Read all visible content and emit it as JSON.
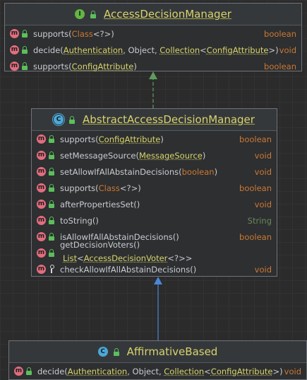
{
  "colors": {
    "canvas": "#2b2b2b",
    "box": "#2d2f31",
    "title": "#d9d46b",
    "keyword": "#cc7832",
    "string_type": "#6a8759",
    "method_icon": "#e36d7e",
    "interface_icon": "#62b543",
    "class_icon": "#4ba8d8",
    "implements_arrow": "#5e9c5e",
    "extends_arrow": "#4a87d6"
  },
  "interface_box": {
    "badge": "I",
    "title": "AccessDecisionManager",
    "rows": [
      {
        "name": "supports(",
        "args": [
          {
            "t": "Class",
            "k": "kw"
          },
          {
            "t": "<?>)",
            "k": "txt"
          }
        ],
        "ret": "boolean"
      },
      {
        "name": "decide(",
        "args": [
          {
            "t": "Authentication",
            "k": "ul"
          },
          {
            "t": ", Object, ",
            "k": "txt"
          },
          {
            "t": "Collection",
            "k": "ul"
          },
          {
            "t": "<",
            "k": "txt"
          },
          {
            "t": "ConfigAttribute",
            "k": "ul"
          },
          {
            "t": ">)",
            "k": "txt"
          }
        ],
        "ret": "void"
      },
      {
        "name": "supports(",
        "args": [
          {
            "t": "ConfigAttribute",
            "k": "ul"
          },
          {
            "t": ")",
            "k": "txt"
          }
        ],
        "ret": "boolean"
      }
    ]
  },
  "abstract_box": {
    "badge": "C",
    "title": "AbstractAccessDecisionManager",
    "rows": [
      {
        "name": "supports(",
        "args": [
          {
            "t": "ConfigAttribute",
            "k": "ul"
          },
          {
            "t": ")",
            "k": "txt"
          }
        ],
        "ret": "boolean"
      },
      {
        "name": "setMessageSource(",
        "args": [
          {
            "t": "MessageSource",
            "k": "ul"
          },
          {
            "t": ")",
            "k": "txt"
          }
        ],
        "ret": "void"
      },
      {
        "name": "setAllowIfAllAbstainDecisions(",
        "args": [
          {
            "t": "boolean",
            "k": "kw"
          },
          {
            "t": ")",
            "k": "txt"
          }
        ],
        "ret": "void"
      },
      {
        "name": "supports(",
        "args": [
          {
            "t": "Class",
            "k": "kw"
          },
          {
            "t": "<?>)",
            "k": "txt"
          }
        ],
        "ret": "boolean"
      },
      {
        "name": "afterPropertiesSet()",
        "args": [],
        "ret": "void"
      },
      {
        "name": "toString()",
        "args": [],
        "ret": "String",
        "ret_kind": "str"
      },
      {
        "name": "isAllowIfAllAbstainDecisions()",
        "args": [],
        "ret": "boolean"
      },
      {
        "name": "getDecisionVoters()",
        "args": [],
        "ret_parts": [
          {
            "t": "List",
            "k": "ul"
          },
          {
            "t": "<",
            "k": "txt"
          },
          {
            "t": "AccessDecisionVoter",
            "k": "ul"
          },
          {
            "t": "<?>>",
            "k": "txt"
          }
        ]
      },
      {
        "name": "checkAllowIfAllAbstainDecisions()",
        "args": [],
        "ret": "void",
        "visibility": "protected"
      }
    ]
  },
  "concrete_box": {
    "badge": "C",
    "title": "AffirmativeBased",
    "rows": [
      {
        "name": "decide(",
        "args": [
          {
            "t": "Authentication",
            "k": "ul"
          },
          {
            "t": ", Object, ",
            "k": "txt"
          },
          {
            "t": "Collection",
            "k": "ul"
          },
          {
            "t": "<",
            "k": "txt"
          },
          {
            "t": "ConfigAttribute",
            "k": "ul"
          },
          {
            "t": ">)",
            "k": "txt"
          }
        ],
        "ret": "void"
      }
    ]
  }
}
